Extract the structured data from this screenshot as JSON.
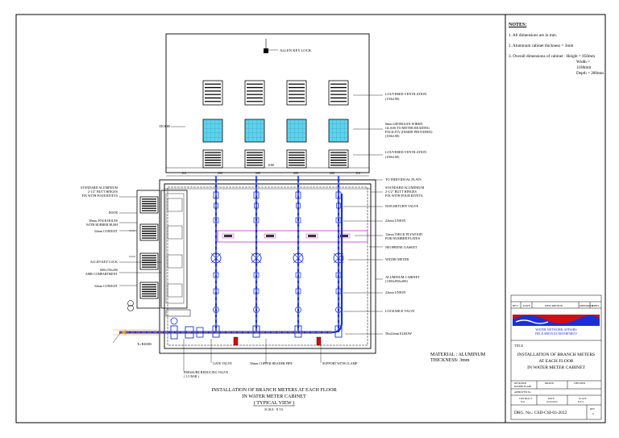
{
  "notes": {
    "heading": "NOTES:",
    "items": [
      "1.  All dimensions are in mm.",
      "2.  Aluminum cabinet thickness = 3mm",
      "3.  Overall dimensions of cabinet : Height = 850mm",
      "Width = 1180mm",
      "Depth = 200mm"
    ]
  },
  "labels": {
    "allen_key_lock_top": "ALLEN KEY LOCK",
    "door_left": "DOOR",
    "louvered_1": "LOUVERED VENTILATION",
    "louvered_1_dim": "(150x100)",
    "georgian_1": "6mm GEORGIAN WIRED",
    "georgian_2": "GLASS TO METER READING",
    "georgian_3": "FACILITY (INSIDE PROVIDED)",
    "georgian_4": "(100x100)",
    "louvered_2": "LOUVERED VENTILATION",
    "louvered_2_dim": "(100x100)",
    "to_plots": "TO INDIVIDUAL PLATS",
    "hinge_r_1": "STANDARD ALUMINIUM",
    "hinge_r_2": "2-1/2\" BUTT HINGES",
    "hinge_r_3": "FIX WITH FOUR RIVETS",
    "non_return": "NON RETURN VALVE",
    "union_top": "22mm UNION",
    "plywood_1": "12mm THICK PLYWOOD",
    "plywood_2": "FOR NUMBER PLATES",
    "neoprene": "NEOPRENE GASKET",
    "water_meter": "WATER METER",
    "alu_cab_1": "ALUMINUM CABINET",
    "alu_cab_2": "(1180x850x200)",
    "union_bottom": "22mm UNION",
    "lockable_valve": "LOCKABLE VALVE",
    "elbow": "50x22mm ELBOW",
    "hinge_l_1": "STANDARD ALUMINIUM",
    "hinge_l_2": "2-1/2\" BUTT HINGES",
    "hinge_l_3": "FIX WITH FOUR RIVETS",
    "door_l2": "DOOR",
    "holes_1": "30mm FOUR HOLES",
    "holes_2": "WITH RUBBER BUSH",
    "conduit_1": "32mm CONDUIT",
    "allen_key_lock_left": "ALLEN KEY LOCK",
    "amr_1": "600x150x200",
    "amr_2": "AMR COMPARTMENT",
    "conduit_2": "32mm CONDUIT",
    "to_riser": "To RISER",
    "gate_valve": "GATE VALVE",
    "copper_header": "50mm COPPER HEADER PIPE",
    "support_clamp": "SUPPORT WITH CLAMP",
    "prv_1": "PRESSURE REDUCING VALVE",
    "prv_2": "( 3.5 BAR )",
    "material_1": "MATERIAL : ALUMINUM",
    "material_2": "THICKNESS: 3mm"
  },
  "drawing_title": {
    "line1": "INSTALLATION OF BRANCH METERS AT EACH FLOOR",
    "line2": "IN WATER METER CABINET",
    "line3": "( TYPICAL VIEW )",
    "scale": "SCALE - N.T.S."
  },
  "dimensions": {
    "overall": "1180",
    "d1": "110",
    "d2": "200",
    "d3": "200",
    "d4": "200",
    "d5": "200",
    "d6": "110"
  },
  "title_block": {
    "rev_headers": [
      "REV",
      "DATE",
      "DESCRIPTION",
      "PREPARED",
      "APPD"
    ],
    "logo_text_1": "WATER NETWORK AFFAIRS",
    "logo_text_2": "FIELD SERVICES DEPARTMENT",
    "title_label": "TITLE",
    "title_1": "INSTALLATION OF BRANCH METERS",
    "title_2": "AT EACH FLOOR",
    "title_3": "IN WATER METER CABINET",
    "row1": [
      "DESIGNED",
      "DRAWN",
      "CHECKED"
    ],
    "row1_sub": [
      "RASHID ELAIB",
      "",
      ""
    ],
    "row2": [
      "APPROVED No.",
      ""
    ],
    "row3": [
      "CONTRACT",
      "DATE",
      "SCALE"
    ],
    "row3_sub": [
      "N/A",
      "10/10/2012",
      "N.T.S."
    ],
    "dwg_no": "DRG. No.: CSD-CSI-03-2012",
    "rev": "REV",
    "rev_val": "0"
  },
  "colors": {
    "pipe_blue": "#1a2fd6",
    "glass_cyan": "#5fd3ec",
    "plate_magenta": "#cc33cc",
    "header_orange": "#e89a2a",
    "valve_red": "#d01010"
  }
}
